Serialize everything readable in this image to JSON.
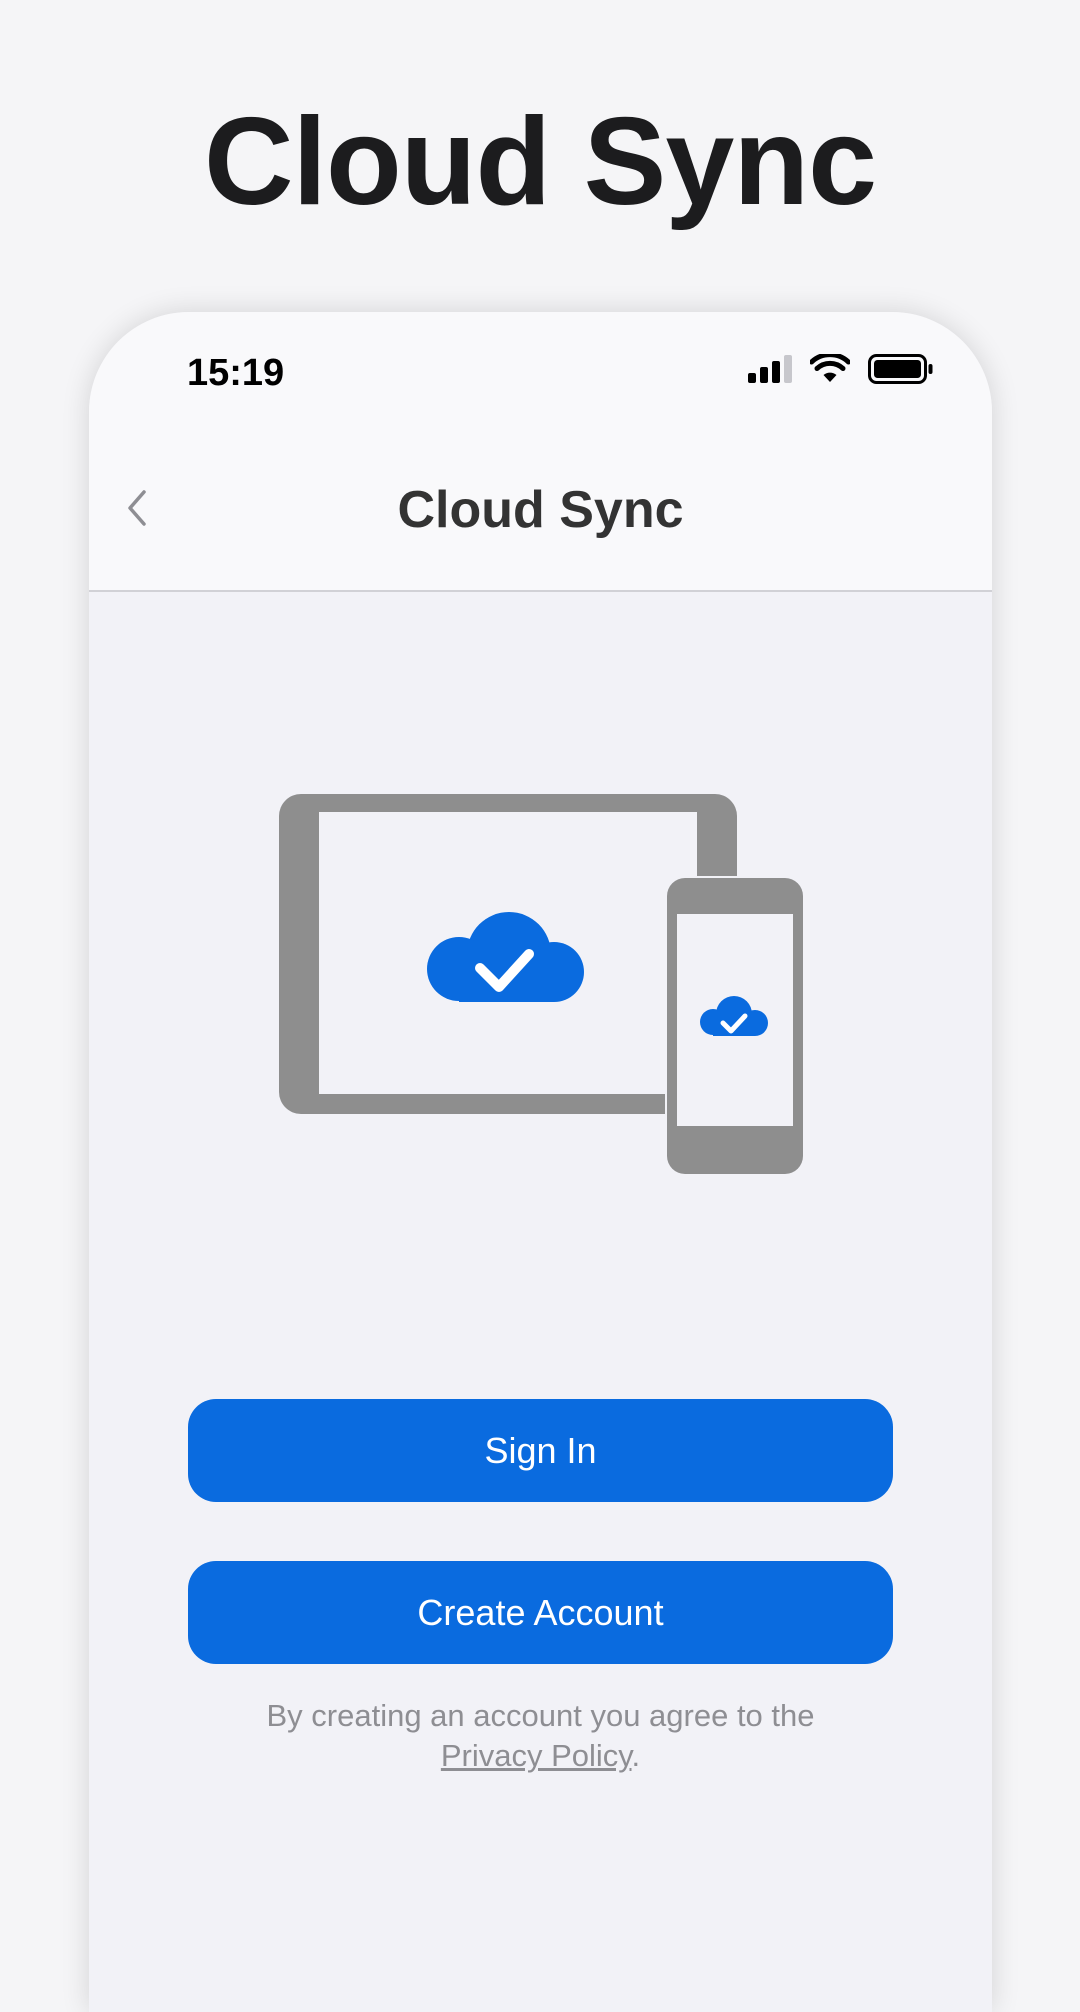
{
  "hero": {
    "title": "Cloud Sync"
  },
  "status_bar": {
    "time": "15:19"
  },
  "nav": {
    "title": "Cloud Sync"
  },
  "actions": {
    "sign_in_label": "Sign In",
    "create_account_label": "Create Account"
  },
  "legal": {
    "prefix": "By creating an account you agree to the",
    "link": "Privacy Policy",
    "suffix": "."
  },
  "icons": {
    "back": "chevron-left-icon",
    "signal": "cellular-signal-icon",
    "wifi": "wifi-icon",
    "battery": "battery-icon",
    "tablet": "tablet-icon",
    "phone": "phone-icon",
    "cloud_check": "cloud-check-icon"
  },
  "colors": {
    "accent": "#0a6bdf",
    "device_gray": "#8e8e8e",
    "background": "#f2f2f7"
  }
}
